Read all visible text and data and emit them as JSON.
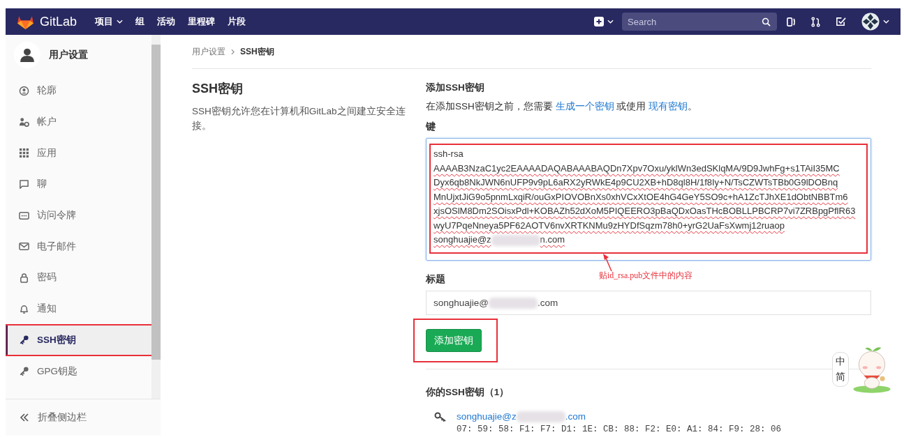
{
  "navbar": {
    "brand": "GitLab",
    "links": [
      {
        "label": "项目",
        "dropdown": true
      },
      {
        "label": "组",
        "dropdown": false
      },
      {
        "label": "活动",
        "dropdown": false
      },
      {
        "label": "里程碑",
        "dropdown": false
      },
      {
        "label": "片段",
        "dropdown": false
      }
    ],
    "search": {
      "placeholder": "Search"
    }
  },
  "sidebar": {
    "title": "用户设置",
    "items": [
      {
        "label": "轮廓",
        "selected": false,
        "highlighted": false
      },
      {
        "label": "帐户",
        "selected": false,
        "highlighted": false
      },
      {
        "label": "应用",
        "selected": false,
        "highlighted": false
      },
      {
        "label": "聊",
        "selected": false,
        "highlighted": false
      },
      {
        "label": "访问令牌",
        "selected": false,
        "highlighted": false
      },
      {
        "label": "电子邮件",
        "selected": false,
        "highlighted": false
      },
      {
        "label": "密码",
        "selected": false,
        "highlighted": false
      },
      {
        "label": "通知",
        "selected": false,
        "highlighted": false
      },
      {
        "label": "SSH密钥",
        "selected": true,
        "highlighted": true
      },
      {
        "label": "GPG钥匙",
        "selected": false,
        "highlighted": false
      }
    ],
    "collapse": "折叠侧边栏"
  },
  "breadcrumb": [
    "用户设置",
    "SSH密钥"
  ],
  "intro": {
    "title": "SSH密钥",
    "description": "SSH密钥允许您在计算机和GitLab之间建立安全连接。"
  },
  "add_key": {
    "heading": "添加SSH密钥",
    "hint": {
      "before": "在添加SSH密钥之前，您需要",
      "link_generate": "生成一个密钥",
      "middle": "或使用",
      "link_existing": "现有密钥",
      "after": "。"
    },
    "key_label": "键",
    "key_lines": [
      "ssh-rsa",
      "AAAAB3NzaC1yc2EAAAADAQABAAABAQDn7Xpv7Oxu/yklWn3edSKlqMA/9D9JwhFg+s1TAiI35MC",
      "Dyx6qb8NkJWN6nUFP9v9pL6aRX2yRWkE4p9CU2XB+hD8ql8H/1f8Iy+N/TsCZWTsTBb0G9lDOBnq",
      "MnUjxtJiG9o5pnmLxqiR/ouGxPIOVOBnXs0xhVCxXtOE4hG4GeY5SO9c+hA1ZcTJhXE1dObtNBBTm6",
      "xjsOSlM8Dm2SOisxPdl+KOBAZh52dXoM5PIQEERO3pBaQDxOasTHcBOBLLPBCRP7vi7ZRBpgPflR63",
      "wyU7PqeNneya5PF62AOTV6nvXRTKNMu9zHYDfSqzm78h0+yrG2UaFsXwmj12ruaop"
    ],
    "key_email": {
      "prefix": "songhuajie@z",
      "suffix": "n.com"
    },
    "key_highlighted": true,
    "note": "贴id_rsa.pub文件中的内容",
    "title_label": "标题",
    "title_value": {
      "prefix": "songhuajie@",
      "suffix": ".com"
    },
    "submit": "添加密钥",
    "submit_highlighted": true
  },
  "keys": {
    "heading": "你的SSH密钥（1）",
    "items": [
      {
        "title": {
          "prefix": "songhuajie@z",
          "suffix": ".com"
        },
        "fingerprint": "07: 59: 58: F1: F7: D1: 1E: CB: 88: F2: E0: A1: 84: F9: 28: 06"
      }
    ]
  },
  "ime_widget": {
    "mode": "中",
    "script": "简"
  }
}
